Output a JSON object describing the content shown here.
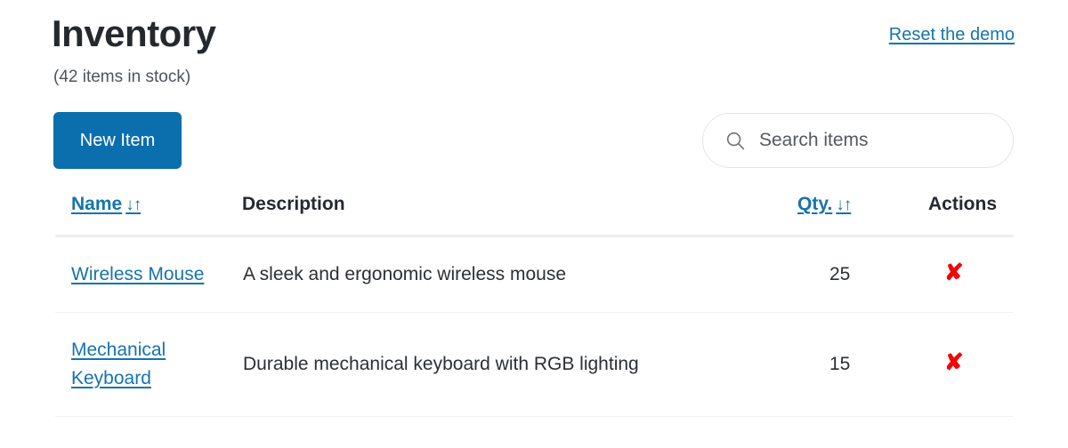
{
  "header": {
    "title": "Inventory",
    "subtitle": "(42 items in stock)",
    "reset_link": "Reset the demo"
  },
  "toolbar": {
    "new_item_label": "New Item",
    "search_placeholder": "Search items",
    "search_value": "",
    "search_icon": "search-icon"
  },
  "table": {
    "columns": {
      "name": "Name",
      "description": "Description",
      "qty": "Qty.",
      "actions": "Actions"
    },
    "sort_arrows": "↓↑",
    "rows": [
      {
        "name": "Wireless Mouse",
        "description": "A sleek and ergonomic wireless mouse",
        "qty": "25",
        "delete_icon": "✘"
      },
      {
        "name": "Mechanical Keyboard",
        "description": "Durable mechanical keyboard with RGB lighting",
        "qty": "15",
        "delete_icon": "✘"
      }
    ]
  },
  "colors": {
    "accent_blue": "#1574ac",
    "button_blue": "#0b6ead",
    "delete_red": "#ef0808",
    "title_dark": "#25292e",
    "border_light": "#eef0f2"
  }
}
